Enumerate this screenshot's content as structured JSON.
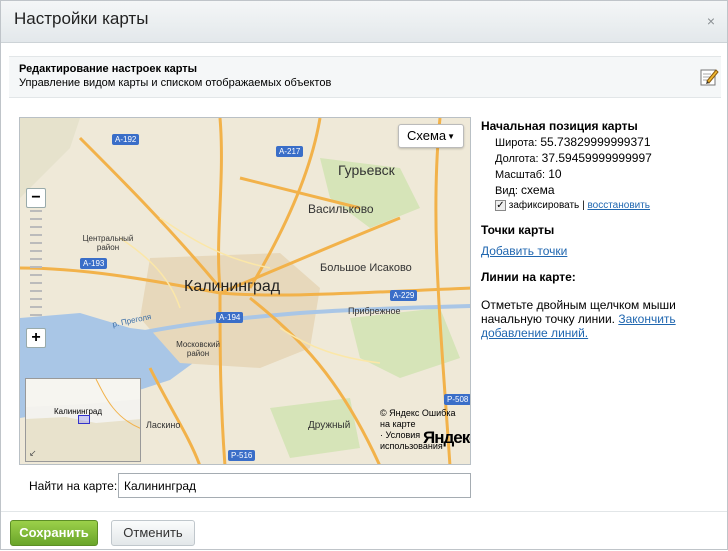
{
  "dialog": {
    "title": "Настройки карты",
    "close_symbol": "×"
  },
  "header": {
    "title": "Редактирование настроек карты",
    "subtitle": "Управление видом карты и списком отображаемых объектов",
    "icon": "edit-pencil-icon"
  },
  "map": {
    "type_button": "Схема",
    "type_button_arrow": "▼",
    "zoom_minus": "−",
    "zoom_plus": "+",
    "labels": {
      "kaliningrad": "Калининград",
      "guryevsk": "Гурьевск",
      "vasilkovo": "Васильково",
      "bolshoe_isakovo": "Большое Исаково",
      "pribrezhnoe": "Прибрежное",
      "central_district": "Центральный район",
      "moskovsky_district": "Московский район",
      "laskino": "Ласкино",
      "druzhny": "Дружный",
      "pregolya": "р. Преголя"
    },
    "roads": {
      "a192": "А-192",
      "a217": "А-217",
      "a193": "А-193",
      "a194": "А-194",
      "a229": "А-229",
      "p508": "Р-508",
      "p516": "Р-516"
    },
    "minimap_label": "Калининград",
    "minimap_arrow": "↙",
    "copyright_prefix": "© Яндекс",
    "error_link": "Ошибка на карте",
    "terms_prefix": "·",
    "terms_link": "Условия использования",
    "logo": "Яндекс"
  },
  "find": {
    "label": "Найти на карте:",
    "value": "Калининград"
  },
  "position": {
    "title": "Начальная позиция карты",
    "latitude_label": "Широта:",
    "latitude": "55.73829999999371",
    "longitude_label": "Долгота:",
    "longitude": "37.59459999999997",
    "scale_label": "Масштаб:",
    "scale": "10",
    "view_label": "Вид:",
    "view": "схема",
    "fixed_label": "зафиксировать",
    "separator": "|",
    "restore_link": "восстановить"
  },
  "points": {
    "title": "Точки карты",
    "add_link": "Добавить точки"
  },
  "lines": {
    "title": "Линии на карте:",
    "text": "Отметьте двойным щелчком мыши начальную точку линии.",
    "finish_link": "Закончить добавление линий."
  },
  "footer": {
    "save": "Сохранить",
    "cancel": "Отменить"
  }
}
